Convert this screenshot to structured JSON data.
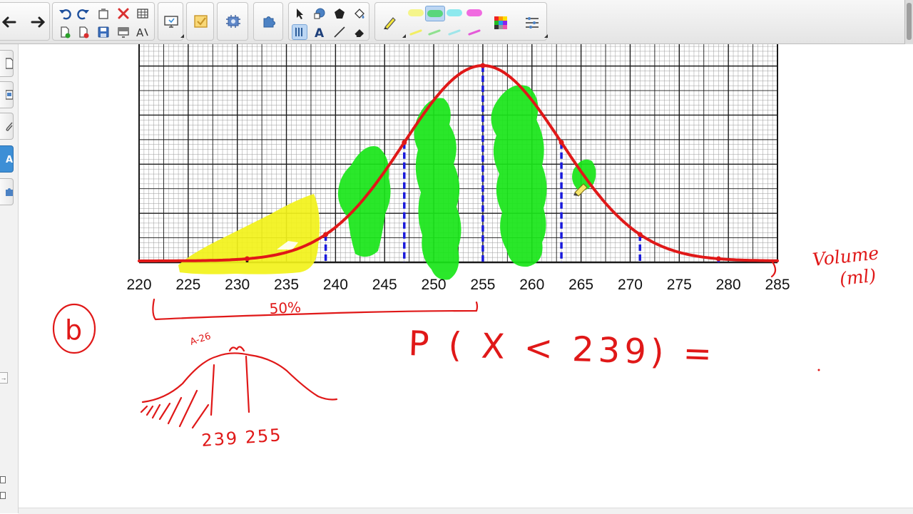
{
  "toolbar": {
    "icons": [
      "back-arrow",
      "forward-arrow",
      "undo",
      "redo",
      "clear-page",
      "delete",
      "table",
      "new-page",
      "delete-page",
      "save",
      "screen-shade",
      "display",
      "text-recognition",
      "response",
      "document-camera",
      "add-ons",
      "select",
      "shapes",
      "regular-polygon",
      "fill",
      "pen-select",
      "text",
      "line",
      "eraser",
      "highlighter",
      "color-palette",
      "properties"
    ]
  },
  "colors": {
    "grid_line": "#1a1a1a",
    "grid_minor": "#9a9a9a",
    "curve": "#e01818",
    "dashed": "#1a1adc",
    "green_fill": "#19e619",
    "yellow_fill": "#f2f21a",
    "ink_red": "#e01818"
  },
  "chart_data": {
    "type": "area",
    "curve": "normal-distribution",
    "x": [
      220,
      225,
      230,
      235,
      240,
      245,
      250,
      255,
      260,
      265,
      270,
      275,
      280,
      285
    ],
    "xlim": [
      220,
      285
    ],
    "dashed_lines_at": [
      231,
      239,
      247,
      255,
      263,
      271,
      279
    ],
    "tick_labels": [
      "220",
      "225",
      "230",
      "235",
      "240",
      "245",
      "250",
      "255",
      "260",
      "265",
      "270",
      "275",
      "280",
      "285"
    ]
  },
  "annotations": {
    "axis_label_line1": "Volume",
    "axis_label_line2": "(ml)",
    "percent_note": "50%",
    "part_label": "b",
    "probability_expression": "P ( X < 239) =",
    "sketch_labels": "239 255",
    "sketch_small_note": "A-26"
  }
}
